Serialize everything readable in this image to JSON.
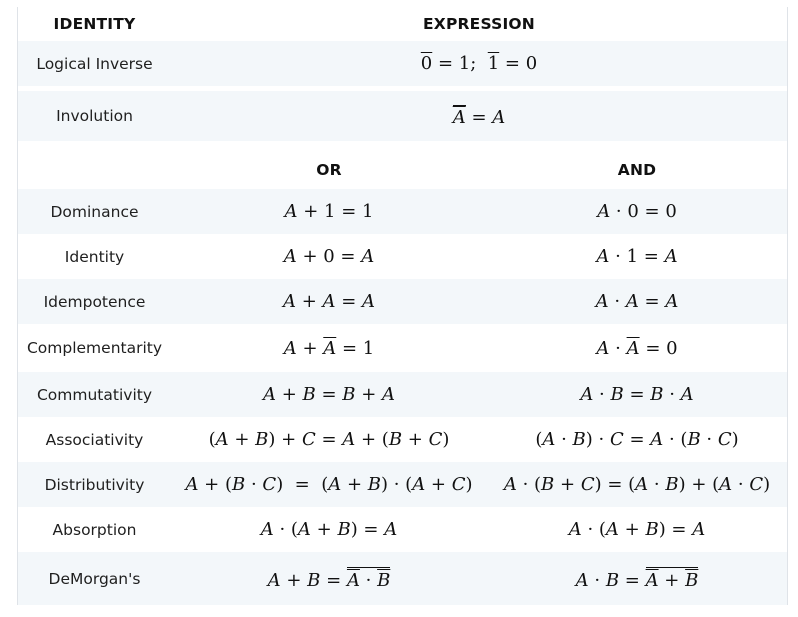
{
  "header": {
    "identity": "IDENTITY",
    "expression": "EXPRESSION"
  },
  "subheader": {
    "or": "OR",
    "and": "AND"
  },
  "rows": [
    {
      "label": "Logical Inverse",
      "expression": "0̄ = 1;  1̄ = 0"
    },
    {
      "label": "Involution",
      "expression": "A̿ = A"
    },
    {
      "label": "Dominance",
      "or": "A + 1 = 1",
      "and": "A · 0 = 0"
    },
    {
      "label": "Identity",
      "or": "A + 0 = A",
      "and": "A · 1 = A"
    },
    {
      "label": "Idempotence",
      "or": "A + A = A",
      "and": "A · A = A"
    },
    {
      "label": "Complementarity",
      "or": "A + Ā = 1",
      "and": "A · Ā = 0"
    },
    {
      "label": "Commutativity",
      "or": "A + B = B + A",
      "and": "A · B = B · A"
    },
    {
      "label": "Associativity",
      "or": "(A + B) + C = A + (B + C)",
      "and": "(A · B) · C = A · (B · C)"
    },
    {
      "label": "Distributivity",
      "or": "A + (B · C) = (A + B) · (A + C)",
      "and": "A · (B + C) = (A · B) + (A · C)"
    },
    {
      "label": "Absorption",
      "or": "A · (A + B) = A",
      "and": "A · (A + B) = A"
    },
    {
      "label": "DeMorgan's",
      "or": "A + B (overlined) = Ā · B̄",
      "and": "A · B (overlined) = Ā + B̄"
    }
  ]
}
